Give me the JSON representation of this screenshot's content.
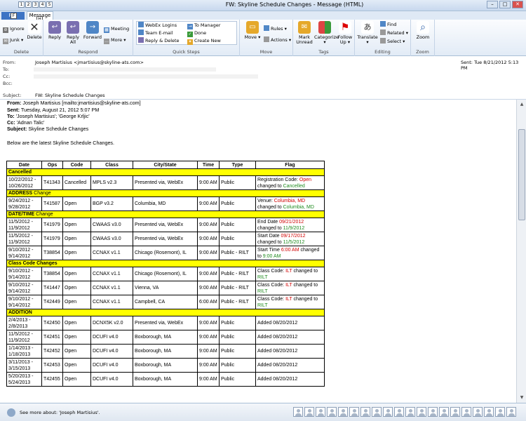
{
  "window": {
    "title": "FW: Skyline Schedule Changes  -  Message (HTML)",
    "qat": [
      "1",
      "2",
      "3",
      "4",
      "5"
    ],
    "min": "–",
    "max": "□",
    "close": "✕"
  },
  "tabs": {
    "file": "File",
    "message": "Message",
    "keytips": {
      "file": "F",
      "message": "H"
    }
  },
  "ribbon": {
    "delete_group": {
      "ignore": "Ignore",
      "junk": "Junk",
      "delete": "Delete",
      "label": "Delete"
    },
    "respond_group": {
      "reply": "Reply",
      "reply_all": "Reply All",
      "forward": "Forward",
      "meeting": "Meeting",
      "more": "More",
      "label": "Respond"
    },
    "quick_steps": {
      "items": [
        "WebEx Logins",
        "Team E-mail",
        "Reply & Delete",
        "To Manager",
        "Done",
        "Create New"
      ],
      "label": "Quick Steps"
    },
    "move_group": {
      "move": "Move",
      "rules": "Rules",
      "actions": "Actions",
      "label": "Move"
    },
    "tags_group": {
      "mark_unread": "Mark Unread",
      "categorize": "Categorize",
      "follow_up": "Follow Up",
      "label": "Tags"
    },
    "editing_group": {
      "translate": "Translate",
      "find": "Find",
      "related": "Related",
      "select": "Select",
      "label": "Editing"
    },
    "zoom_group": {
      "zoom": "Zoom",
      "label": "Zoom"
    }
  },
  "header": {
    "from_label": "From:",
    "from_value": "Joseph Martisius <jmartisius@skyline-ats.com>",
    "to_label": "To:",
    "cc_label": "Cc:",
    "bcc_label": "Bcc:",
    "subject_label": "Subject:",
    "subject_value": "FW: Skyline Schedule Changes",
    "sent_label": "Sent:",
    "sent_value": "Tue 8/21/2012 5:13 PM"
  },
  "forwarded": {
    "from_label": "From:",
    "from_value": "Joseph Martisius [mailto:jmartisius@skyline-ats.com]",
    "sent_label": "Sent:",
    "sent_value": "Tuesday, August 21, 2012 5:07 PM",
    "to_label": "To:",
    "to_value": "'Joseph Martisius'; 'George Krljic'",
    "cc_label": "Cc:",
    "cc_value": "'Adnan Talic'",
    "subject_label": "Subject:",
    "subject_value": "Skyline Schedule Changes",
    "intro": "Below are the latest Skyline Schedule Changes."
  },
  "table": {
    "columns": [
      "Date",
      "Ops",
      "Code",
      "Class",
      "City/State",
      "Time",
      "Type",
      "Flag"
    ],
    "sections": [
      {
        "title": "Cancelled",
        "rest": ""
      },
      {
        "title": "ADDRESS",
        "rest": " Change"
      },
      {
        "title": "DATE/TIME",
        "rest": " Change"
      },
      {
        "title": "Class Code Changes",
        "rest": ""
      },
      {
        "title": "ADDITION",
        "rest": ""
      }
    ],
    "rows": [
      {
        "date": "10/22/2012 - 10/26/2012",
        "ops": "T41343",
        "code": "Cancelled",
        "class": "MPLS v2.3",
        "city": "Presented via, WebEx",
        "time": "9:00 AM",
        "type": "Public",
        "flag": {
          "a": "Registration Code: ",
          "b": "Open",
          "c": " changed to ",
          "d": "Cancelled"
        }
      },
      {
        "date": "9/24/2012 - 9/28/2012",
        "ops": "T41587",
        "code": "Open",
        "class": "BGP v3.2",
        "city": "Columbia, MD",
        "time": "9:00 AM",
        "type": "Public",
        "flag": {
          "a": "Venue: ",
          "b": "Columbia, MD",
          "c": " changed to ",
          "d": "Columbia, MD"
        }
      },
      {
        "date": "11/5/2012 - 11/9/2012",
        "ops": "T41979",
        "code": "Open",
        "class": "CWAAS v3.0",
        "city": "Presented via, WebEx",
        "time": "9:00 AM",
        "type": "Public",
        "flag": {
          "a": "End Date ",
          "b": "09/21/2012",
          "c": " changed to ",
          "d": "11/9/2012"
        }
      },
      {
        "date": "11/5/2012 - 11/9/2012",
        "ops": "T41979",
        "code": "Open",
        "class": "CWAAS v3.0",
        "city": "Presented via, WebEx",
        "time": "9:00 AM",
        "type": "Public",
        "flag": {
          "a": "Start Date ",
          "b": "09/17/2012",
          "c": " changed to ",
          "d": "11/5/2012"
        }
      },
      {
        "date": "9/10/2012 - 9/14/2012",
        "ops": "T38854",
        "code": "Open",
        "class": "CCNAX v1.1",
        "city": "Chicago (Rosemont), IL",
        "time": "9:00 AM",
        "type": "Public - RILT",
        "flag": {
          "a": "Start Time ",
          "b": "6:00 AM",
          "c": " changed to ",
          "d": "9:00 AM"
        }
      },
      {
        "date": "9/10/2012 - 9/14/2012",
        "ops": "T38854",
        "code": "Open",
        "class": "CCNAX v1.1",
        "city": "Chicago (Rosemont), IL",
        "time": "9:00 AM",
        "type": "Public - RILT",
        "flag": {
          "a": "Class Code: ",
          "b": "ILT",
          "c": " changed to ",
          "d": "RILT"
        }
      },
      {
        "date": "9/10/2012 - 9/14/2012",
        "ops": "T41447",
        "code": "Open",
        "class": "CCNAX v1.1",
        "city": "Vienna, VA",
        "time": "9:00 AM",
        "type": "Public - RILT",
        "flag": {
          "a": "Class Code: ",
          "b": "ILT",
          "c": " changed to ",
          "d": "RILT"
        }
      },
      {
        "date": "9/10/2012 - 9/14/2012",
        "ops": "T42449",
        "code": "Open",
        "class": "CCNAX v1.1",
        "city": "Campbell, CA",
        "time": "6:00 AM",
        "type": "Public - RILT",
        "flag": {
          "a": "Class Code: ",
          "b": "ILT",
          "c": " changed to ",
          "d": "RILT"
        }
      },
      {
        "date": "2/4/2013 - 2/8/2013",
        "ops": "T42450",
        "code": "Open",
        "class": "DCNX5K v2.0",
        "city": "Presented via, WebEx",
        "time": "9:00 AM",
        "type": "Public",
        "flag": {
          "a": "Added 08/20/2012",
          "b": "",
          "c": "",
          "d": ""
        }
      },
      {
        "date": "11/5/2012 - 11/9/2012",
        "ops": "T42451",
        "code": "Open",
        "class": "DCUFI v4.0",
        "city": "Boxborough, MA",
        "time": "9:00 AM",
        "type": "Public",
        "flag": {
          "a": "Added 08/20/2012",
          "b": "",
          "c": "",
          "d": ""
        }
      },
      {
        "date": "1/14/2013 - 1/18/2013",
        "ops": "T42452",
        "code": "Open",
        "class": "DCUFI v4.0",
        "city": "Boxborough, MA",
        "time": "9:00 AM",
        "type": "Public",
        "flag": {
          "a": "Added 08/20/2012",
          "b": "",
          "c": "",
          "d": ""
        }
      },
      {
        "date": "3/11/2013 - 3/15/2013",
        "ops": "T42453",
        "code": "Open",
        "class": "DCUFI v4.0",
        "city": "Boxborough, MA",
        "time": "9:00 AM",
        "type": "Public",
        "flag": {
          "a": "Added 08/20/2012",
          "b": "",
          "c": "",
          "d": ""
        }
      },
      {
        "date": "5/20/2013 - 5/24/2013",
        "ops": "T42455",
        "code": "Open",
        "class": "DCUFI v4.0",
        "city": "Boxborough, MA",
        "time": "9:00 AM",
        "type": "Public",
        "flag": {
          "a": "Added 08/20/2012",
          "b": "",
          "c": "",
          "d": ""
        }
      }
    ]
  },
  "people_pane": {
    "text": "See more about: 'Joseph Martisius'.",
    "avatar_count": 20
  },
  "colors": {
    "section_bg": "#ffff00",
    "old_value": "#d00000",
    "new_value": "#1e8a1e",
    "file_tab": "#3d74c4"
  }
}
